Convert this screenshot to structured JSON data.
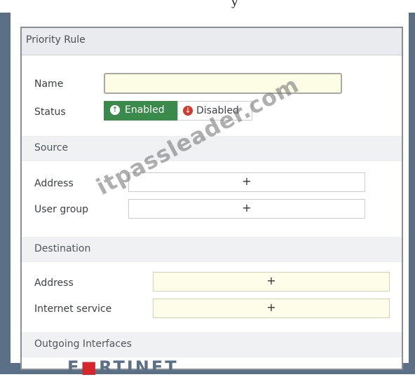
{
  "title_fragment": "y",
  "panel": {
    "title": "Priority Rule"
  },
  "fields": {
    "name_label": "Name",
    "name_value": "",
    "status_label": "Status",
    "enabled_label": "Enabled",
    "disabled_label": "Disabled",
    "status_selected": "Enabled"
  },
  "source": {
    "header": "Source",
    "address_label": "Address",
    "user_group_label": "User group",
    "add_symbol": "+"
  },
  "destination": {
    "header": "Destination",
    "address_label": "Address",
    "internet_service_label": "Internet service",
    "add_symbol": "+"
  },
  "outgoing": {
    "header": "Outgoing Interfaces"
  },
  "watermark": "itpassleader.com",
  "logo": {
    "prefix": "F",
    "mid": "RTINET",
    "brand_color": "#d6262b"
  },
  "colors": {
    "enabled_green": "#3a8a4c",
    "disabled_red": "#d13b2d",
    "frame_blue": "#5b6f86"
  }
}
